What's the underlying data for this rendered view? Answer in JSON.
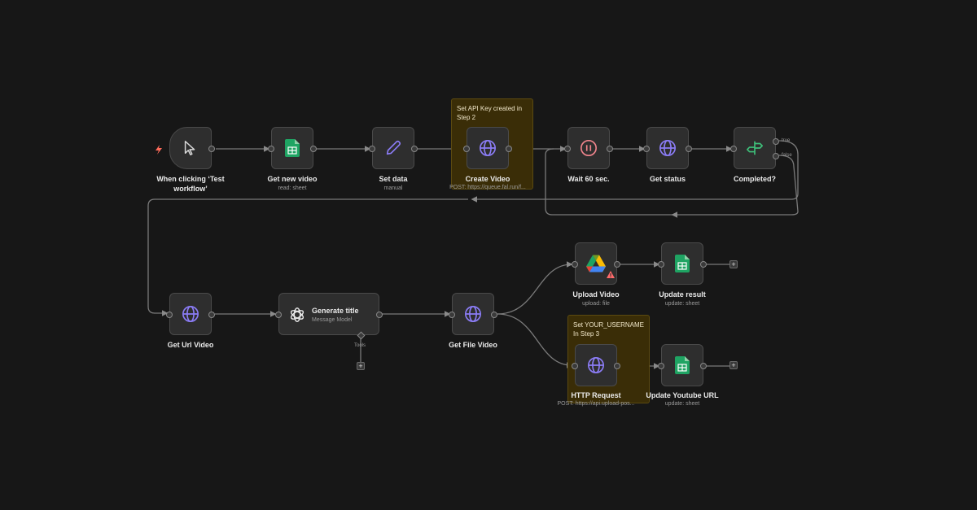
{
  "notes": [
    {
      "text": "Set API Key created in Step 2"
    },
    {
      "text": "Set YOUR_USERNAME In Step 3"
    }
  ],
  "nodes": {
    "trigger": {
      "label": "When clicking ‘Test workflow’",
      "icon": "cursor-icon"
    },
    "get_new_video": {
      "label": "Get new video",
      "sub": "read: sheet",
      "icon": "google-sheets-icon"
    },
    "set_data": {
      "label": "Set data",
      "sub": "manual",
      "icon": "pencil-icon"
    },
    "create_video": {
      "label": "Create Video",
      "sub": "POST: https://queue.fal.run/f...",
      "icon": "globe-icon"
    },
    "wait": {
      "label": "Wait 60 sec.",
      "icon": "pause-icon"
    },
    "get_status": {
      "label": "Get status",
      "icon": "globe-icon"
    },
    "completed": {
      "label": "Completed?",
      "icon": "signpost-icon",
      "true_label": "true",
      "false_label": "false"
    },
    "get_url_video": {
      "label": "Get Url Video",
      "icon": "globe-icon"
    },
    "generate_title": {
      "label": "Generate title",
      "sub": "Message Model",
      "icon": "openai-icon",
      "tools_label": "Tools"
    },
    "get_file_video": {
      "label": "Get File Video",
      "icon": "globe-icon"
    },
    "upload_video": {
      "label": "Upload Video",
      "sub": "upload: file",
      "icon": "google-drive-icon"
    },
    "update_result": {
      "label": "Update result",
      "sub": "update: sheet",
      "icon": "google-sheets-icon"
    },
    "http_request": {
      "label": "HTTP Request",
      "sub": "POST: https://api.upload-pos...",
      "icon": "globe-icon"
    },
    "update_youtube": {
      "label": "Update Youtube URL",
      "sub": "update: sheet",
      "icon": "google-sheets-icon"
    }
  },
  "colors": {
    "background": "#171717",
    "node": "#2e2e2e",
    "globe": "#8b7cf6",
    "sheets": "#1fa463",
    "pause": "#f0848c",
    "signpost": "#3ec07a",
    "trigger_bolt": "#ff6b5a",
    "note": "#3a2d07"
  }
}
